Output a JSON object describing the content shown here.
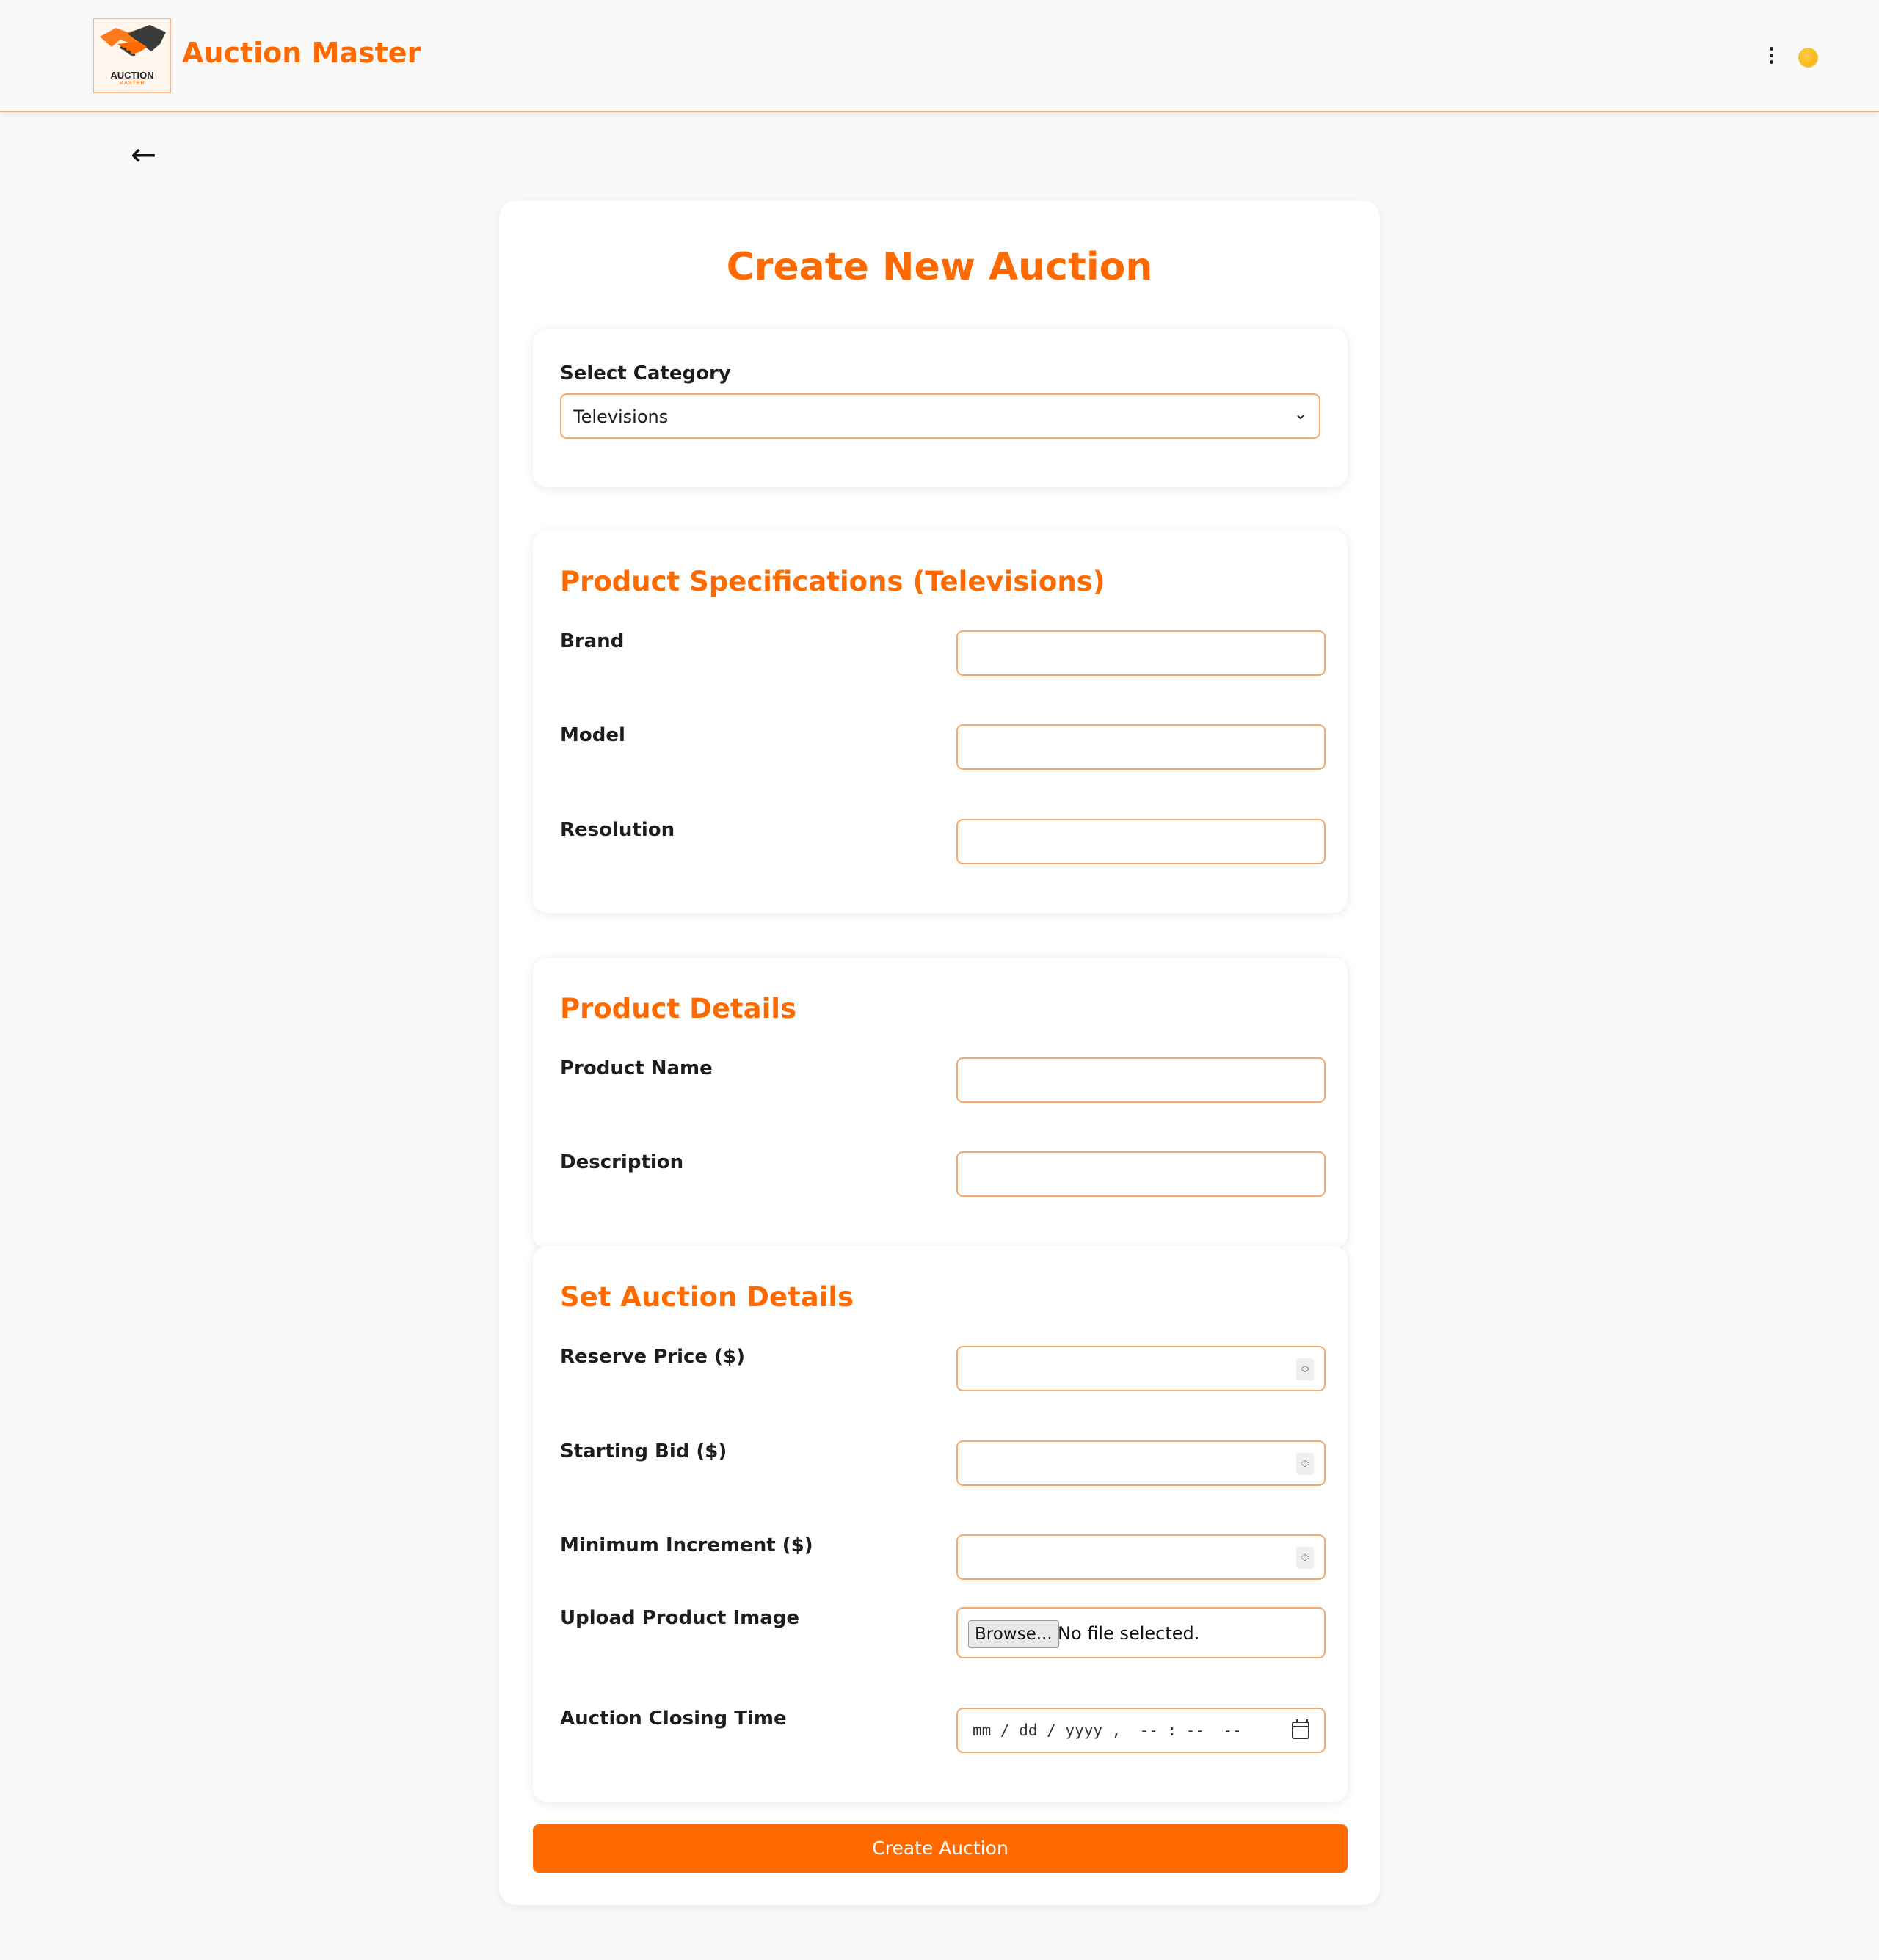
{
  "app": {
    "name": "Auction Master",
    "logo_word": "AUCTION",
    "logo_sub": "MASTER"
  },
  "nav": {
    "back_symbol": "←"
  },
  "page": {
    "title": "Create New Auction"
  },
  "category": {
    "label": "Select Category",
    "selected": "Televisions"
  },
  "specs": {
    "title": "Product Specifications (Televisions)",
    "fields": [
      {
        "label": "Brand",
        "value": ""
      },
      {
        "label": "Model",
        "value": ""
      },
      {
        "label": "Resolution",
        "value": ""
      }
    ]
  },
  "details": {
    "title": "Product Details",
    "fields": [
      {
        "label": "Product Name",
        "value": ""
      },
      {
        "label": "Description",
        "value": ""
      }
    ]
  },
  "auction": {
    "title": "Set Auction Details",
    "reserve_label": "Reserve Price ($)",
    "starting_label": "Starting Bid ($)",
    "increment_label": "Minimum Increment ($)",
    "image_label": "Upload Product Image",
    "browse_label": "Browse...",
    "file_status": "No file selected.",
    "closing_label": "Auction Closing Time",
    "closing_placeholder": "mm / dd / yyyy ,  -- : --  --"
  },
  "actions": {
    "submit": "Create Auction"
  },
  "icons": {
    "menu": "kebab-menu-icon",
    "theme": "sun-icon",
    "calendar": "calendar-icon",
    "chevron": "chevron-down-icon",
    "back": "arrow-left-icon"
  },
  "colors": {
    "accent": "#ff6a00",
    "border": "#f4a96b",
    "background": "#f8f8f8"
  }
}
